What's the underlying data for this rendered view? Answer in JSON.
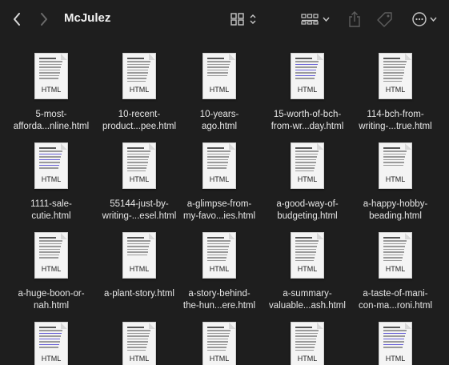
{
  "window": {
    "title": "McJulez",
    "nav": {
      "back_icon": "chevron-left-icon",
      "forward_icon": "chevron-right-icon"
    },
    "toolbar": {
      "view_icon": "grid-view-icon",
      "group_icon": "group-by-icon",
      "share_icon": "share-icon",
      "tag_icon": "tag-icon",
      "more_icon": "more-options-icon"
    }
  },
  "colors": {
    "background": "#1e1e1e",
    "text": "#e6e6e6",
    "thumb_paper": "#f4f4f4",
    "link_blue": "#6a62d8"
  },
  "files": [
    {
      "line1": "5-most-",
      "line2": "afforda...nline.html",
      "badge": "HTML",
      "style": "a"
    },
    {
      "line1": "10-recent-",
      "line2": "product...pee.html",
      "badge": "HTML",
      "style": "b"
    },
    {
      "line1": "10-years-",
      "line2": "ago.html",
      "badge": "HTML",
      "style": "c"
    },
    {
      "line1": "15-worth-of-bch-",
      "line2": "from-wr...day.html",
      "badge": "HTML",
      "style": "d"
    },
    {
      "line1": "114-bch-from-",
      "line2": "writing-...true.html",
      "badge": "HTML",
      "style": "b"
    },
    {
      "line1": "1111-sale-",
      "line2": "cutie.html",
      "badge": "HTML",
      "style": "d"
    },
    {
      "line1": "55144-just-by-",
      "line2": "writing-...esel.html",
      "badge": "HTML",
      "style": "b"
    },
    {
      "line1": "a-glimpse-from-",
      "line2": "my-favo...ies.html",
      "badge": "HTML",
      "style": "a"
    },
    {
      "line1": "a-good-way-of-",
      "line2": "budgeting.html",
      "badge": "HTML",
      "style": "b"
    },
    {
      "line1": "a-happy-hobby-",
      "line2": "beading.html",
      "badge": "HTML",
      "style": "c"
    },
    {
      "line1": "a-huge-boon-or-",
      "line2": "nah.html",
      "badge": "HTML",
      "style": "a"
    },
    {
      "line1": "a-plant-story.html",
      "line2": "",
      "badge": "HTML",
      "style": "c"
    },
    {
      "line1": "a-story-behind-",
      "line2": "the-hun...ere.html",
      "badge": "HTML",
      "style": "b"
    },
    {
      "line1": "a-summary-",
      "line2": "valuable...ash.html",
      "badge": "HTML",
      "style": "b"
    },
    {
      "line1": "a-taste-of-mani-",
      "line2": "con-ma...roni.html",
      "badge": "HTML",
      "style": "b"
    },
    {
      "line1": "",
      "line2": "",
      "badge": "HTML",
      "style": "d"
    },
    {
      "line1": "",
      "line2": "",
      "badge": "HTML",
      "style": "b"
    },
    {
      "line1": "",
      "line2": "",
      "badge": "HTML",
      "style": "b"
    },
    {
      "line1": "",
      "line2": "",
      "badge": "HTML",
      "style": "b"
    },
    {
      "line1": "",
      "line2": "",
      "badge": "HTML",
      "style": "d"
    }
  ]
}
